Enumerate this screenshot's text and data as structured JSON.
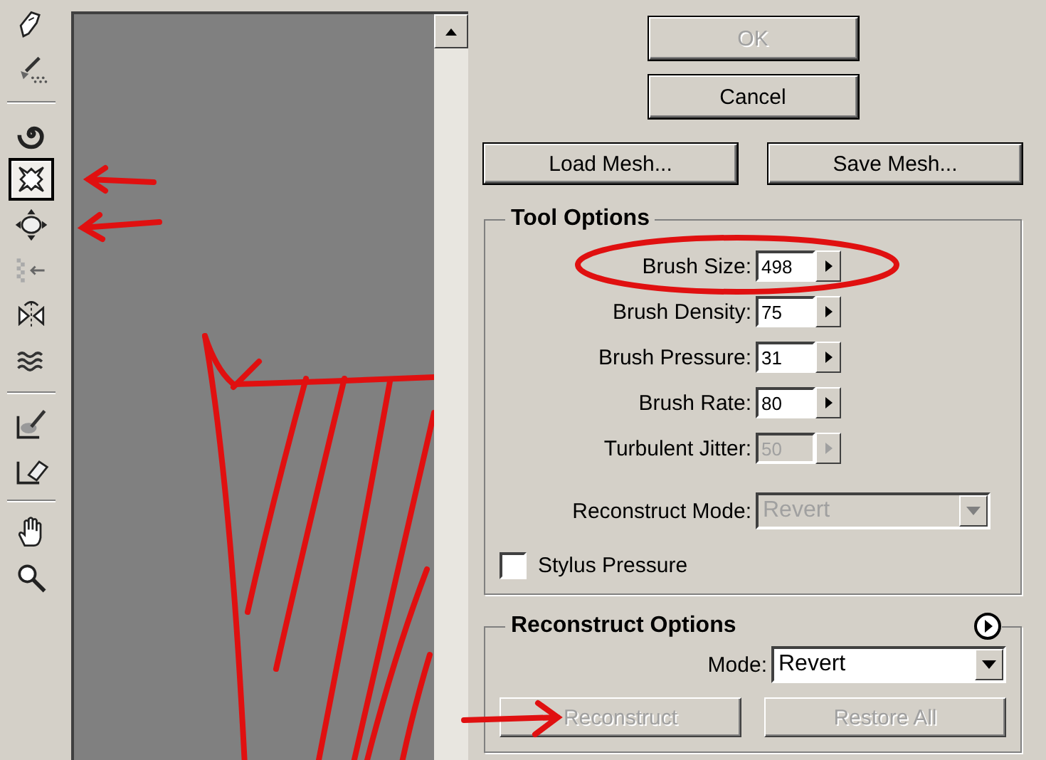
{
  "tool_groups": [
    [
      {
        "kind": "warp",
        "selected": false
      },
      {
        "kind": "reconstruct",
        "selected": false
      }
    ],
    [
      {
        "kind": "twirl",
        "selected": false
      },
      {
        "kind": "pucker",
        "selected": true
      },
      {
        "kind": "bloat",
        "selected": false
      },
      {
        "kind": "shift",
        "selected": false
      },
      {
        "kind": "reflect",
        "selected": false
      },
      {
        "kind": "turbulence",
        "selected": false
      }
    ],
    [
      {
        "kind": "freeze",
        "selected": false
      },
      {
        "kind": "thaw",
        "selected": false
      }
    ],
    [
      {
        "kind": "hand",
        "selected": false
      },
      {
        "kind": "zoom",
        "selected": false
      }
    ]
  ],
  "dialog_buttons": [
    {
      "label": "OK",
      "disabled": true
    },
    {
      "label": "Cancel",
      "disabled": false
    }
  ],
  "mesh_buttons": [
    {
      "label": "Load Mesh..."
    },
    {
      "label": "Save Mesh..."
    }
  ],
  "tool_options": {
    "title": "Tool Options",
    "fields": [
      {
        "label": "Brush Size:",
        "value": "498",
        "disabled": false
      },
      {
        "label": "Brush Density:",
        "value": "75",
        "disabled": false
      },
      {
        "label": "Brush Pressure:",
        "value": "31",
        "disabled": false
      },
      {
        "label": "Brush Rate:",
        "value": "80",
        "disabled": false
      },
      {
        "label": "Turbulent Jitter:",
        "value": "50",
        "disabled": true
      }
    ],
    "reconstruct_mode": {
      "label": "Reconstruct Mode:",
      "value": "Revert",
      "disabled": true
    },
    "stylus_pressure": {
      "label": "Stylus Pressure",
      "checked": false
    }
  },
  "reconstruct_options": {
    "title": "Reconstruct Options",
    "mode": {
      "label": "Mode:",
      "value": "Revert",
      "disabled": false
    },
    "buttons": [
      {
        "label": "Reconstruct",
        "disabled": true
      },
      {
        "label": "Restore All",
        "disabled": true
      }
    ]
  }
}
